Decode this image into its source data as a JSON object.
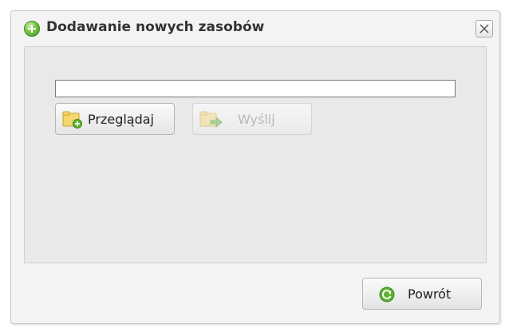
{
  "dialog": {
    "title": "Dodawanie nowych zasobów",
    "title_icon": "add-circle-icon",
    "close_icon": "close-icon"
  },
  "upload": {
    "file_value": "",
    "browse_label": "Przeglądaj",
    "browse_icon": "folder-add-icon",
    "send_label": "Wyślij",
    "send_icon": "folder-upload-icon",
    "send_enabled": false
  },
  "footer": {
    "return_label": "Powrót",
    "return_icon": "refresh-icon"
  },
  "colors": {
    "accent_green": "#5db135",
    "folder_yellow": "#f2c94c"
  }
}
